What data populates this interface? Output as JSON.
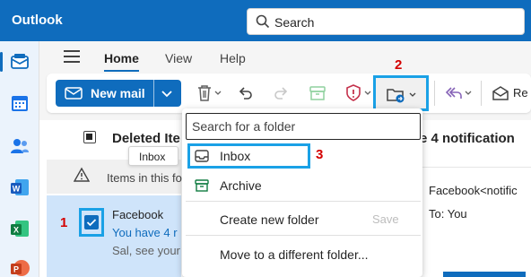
{
  "app": {
    "title": "Outlook"
  },
  "search": {
    "label": "Search"
  },
  "ribbon": {
    "tabs": [
      {
        "label": "Home"
      },
      {
        "label": "View"
      },
      {
        "label": "Help"
      }
    ],
    "new_mail_label": "New mail",
    "reply_partial_label": "Re"
  },
  "message_list": {
    "folder_title": "Deleted Ite",
    "notice_text": "Items in this fo",
    "message": {
      "from": "Facebook",
      "subject": "You have 4 r",
      "preview": "Sal, see your"
    }
  },
  "reading_pane": {
    "title": "e 4 notification",
    "from": "Facebook<notific",
    "to": "To:  You"
  },
  "move_menu": {
    "search_placeholder": "Search for a folder",
    "items": [
      {
        "label": "Inbox"
      },
      {
        "label": "Archive"
      }
    ],
    "create_label": "Create new folder",
    "save_label": "Save",
    "move_label": "Move to a different folder..."
  },
  "tooltip": {
    "text": "Inbox"
  },
  "step_markers": {
    "one": "1",
    "two": "2",
    "three": "3"
  },
  "colors": {
    "brand": "#0f6cbd",
    "highlight_frame": "#1aa1e6",
    "step_number": "#d40000"
  }
}
